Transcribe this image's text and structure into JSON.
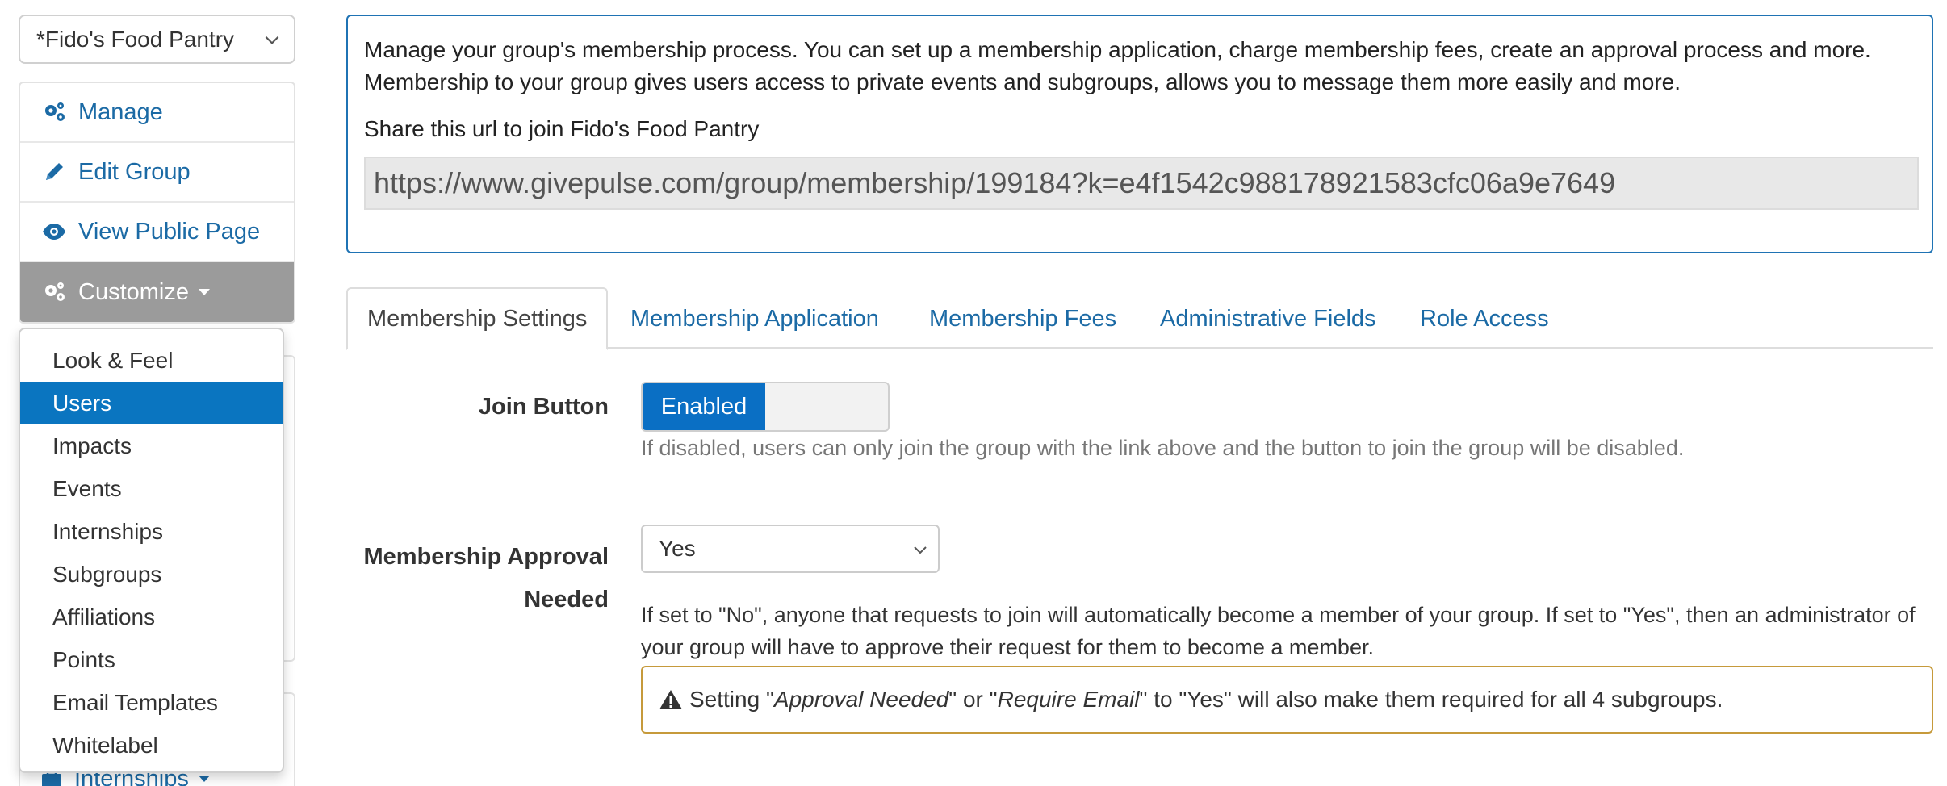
{
  "sidebar": {
    "group_select": "*Fido's Food Pantry",
    "nav": {
      "manage": "Manage",
      "edit_group": "Edit Group",
      "view_public_page": "View Public Page",
      "customize": "Customize"
    },
    "customize_menu": [
      "Look & Feel",
      "Users",
      "Impacts",
      "Events",
      "Internships",
      "Subgroups",
      "Affiliations",
      "Points",
      "Email Templates",
      "Whitelabel"
    ],
    "selected_menu_item": "Users",
    "internships_label": "Internships"
  },
  "info": {
    "description": "Manage your group's membership process. You can set up a membership application, charge membership fees, create an approval process and more. Membership to your group gives users access to private events and subgroups, allows you to message them more easily and more.",
    "share_label": "Share this url to join Fido's Food Pantry",
    "share_url": "https://www.givepulse.com/group/membership/199184?k=e4f1542c988178921583cfc06a9e7649"
  },
  "tabs": [
    "Membership Settings",
    "Membership Application",
    "Membership Fees",
    "Administrative Fields",
    "Role Access"
  ],
  "form": {
    "join_button": {
      "label": "Join Button",
      "toggle_state": "Enabled",
      "help": "If disabled, users can only join the group with the link above and the button to join the group will be disabled."
    },
    "approval": {
      "label_line1": "Membership Approval",
      "label_line2": "Needed",
      "value": "Yes",
      "help": "If set to \"No\", anyone that requests to join will automatically become a member of your group. If set to \"Yes\", then an administrator of your group will have to approve their request for them to become a member."
    },
    "warning": {
      "part1": "Setting \"",
      "approval_needed": "Approval Needed",
      "part2": "\" or \"",
      "require_email": "Require Email",
      "part3": "\" to \"Yes\" will also make them required for all 4 subgroups."
    }
  },
  "colors": {
    "link": "#1b6aa5",
    "primary": "#0a75c0",
    "info_border": "#1f73b4",
    "warning_border": "#c69a3b",
    "active_nav_bg": "#9b9b9b"
  }
}
